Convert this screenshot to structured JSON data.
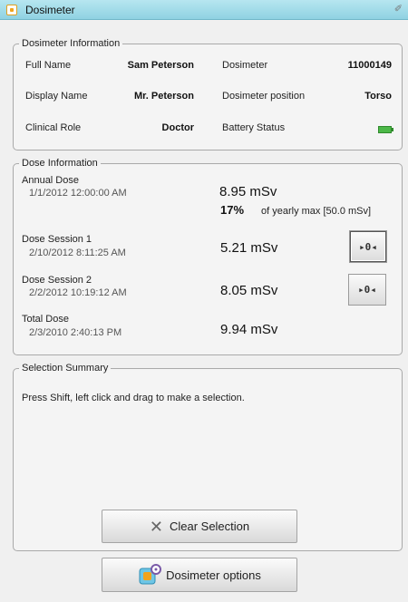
{
  "window": {
    "title": "Dosimeter"
  },
  "info": {
    "legend": "Dosimeter Information",
    "full_name_label": "Full Name",
    "full_name": "Sam Peterson",
    "display_name_label": "Display Name",
    "display_name": "Mr. Peterson",
    "clinical_role_label": "Clinical Role",
    "clinical_role": "Doctor",
    "dosimeter_label": "Dosimeter",
    "dosimeter": "11000149",
    "position_label": "Dosimeter position",
    "position": "Torso",
    "battery_label": "Battery Status",
    "battery_level": "full",
    "battery_color": "#4cb848"
  },
  "dose": {
    "legend": "Dose Information",
    "annual": {
      "label": "Annual Dose",
      "date": "1/1/2012 12:00:00 AM",
      "value": "8.95 mSv",
      "percent": "17%",
      "percent_note": "of yearly max [50.0 mSv]"
    },
    "session1": {
      "label": "Dose Session 1",
      "date": "2/10/2012 8:11:25 AM",
      "value": "5.21 mSv",
      "button_icon": "play-session-icon"
    },
    "session2": {
      "label": "Dose Session 2",
      "date": "2/2/2012 10:19:12 AM",
      "value": "8.05 mSv",
      "button_icon": "play-session-icon"
    },
    "total": {
      "label": "Total Dose",
      "date": "2/3/2010 2:40:13 PM",
      "value": "9.94 mSv"
    }
  },
  "selection": {
    "legend": "Selection Summary",
    "hint": "Press Shift, left click and drag to make a selection.",
    "clear_label": "Clear Selection"
  },
  "options": {
    "label": "Dosimeter options"
  }
}
